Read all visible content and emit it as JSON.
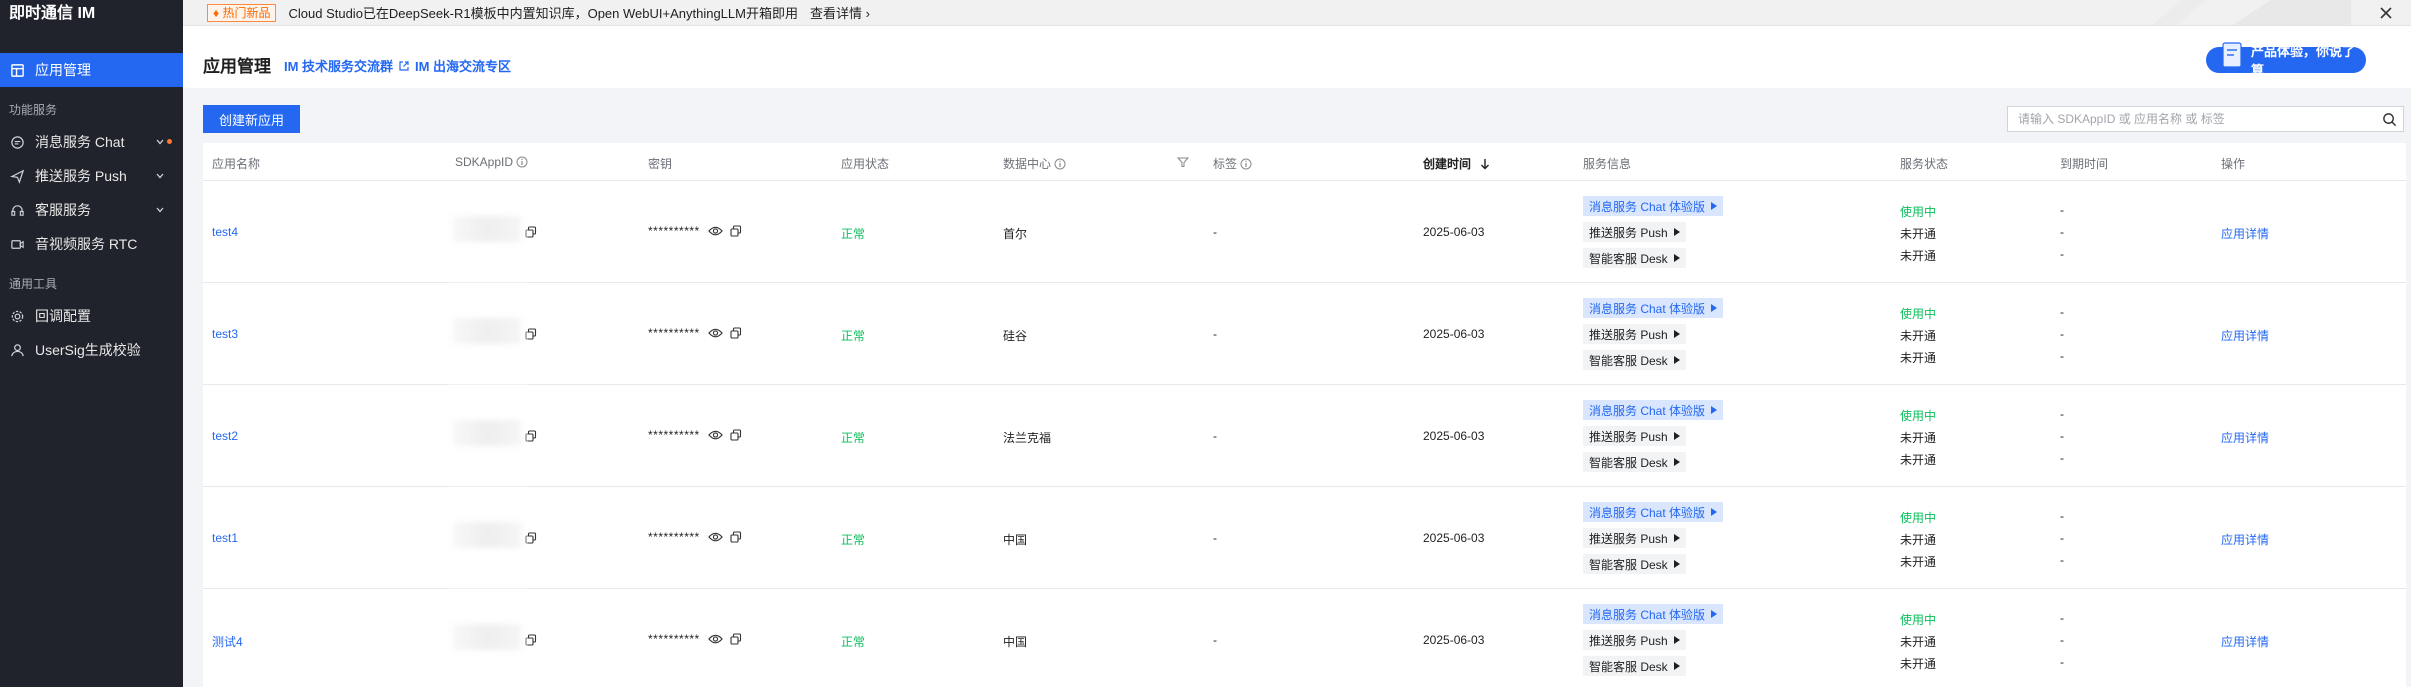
{
  "sidebar": {
    "brand": "即时通信 IM",
    "items": [
      {
        "label": "应用管理",
        "icon": "app-grid-icon"
      },
      {
        "label": "消息服务 Chat",
        "icon": "chat-bubble-icon"
      },
      {
        "label": "推送服务 Push",
        "icon": "push-send-icon"
      },
      {
        "label": "客服服务",
        "icon": "headset-icon"
      },
      {
        "label": "音视频服务 RTC",
        "icon": "video-camera-icon"
      },
      {
        "label": "回调配置",
        "icon": "gear-icon"
      },
      {
        "label": "UserSig生成校验",
        "icon": "user-key-icon"
      }
    ],
    "groups": [
      "功能服务",
      "通用工具"
    ]
  },
  "banner": {
    "tag": "热门新品",
    "text": "Cloud Studio已在DeepSeek-R1模板中内置知识库，Open WebUI+AnythingLLM开箱即用",
    "link": "查看详情"
  },
  "header": {
    "title": "应用管理",
    "link1": "IM 技术服务交流群",
    "link2": "IM 出海交流专区",
    "promo": "产品体验，你说了算"
  },
  "toolbar": {
    "create_label": "创建新应用",
    "search_placeholder": "请输入 SDKAppID 或 应用名称 或 标签"
  },
  "table": {
    "headers": {
      "name": "应用名称",
      "sdkappid": "SDKAppID",
      "secret": "密钥",
      "status": "应用状态",
      "datacenter": "数据中心",
      "tags": "标签",
      "created": "创建时间",
      "services": "服务信息",
      "svc_status": "服务状态",
      "expire": "到期时间",
      "ops": "操作"
    },
    "rows": [
      {
        "name": "test4",
        "secret": "**********",
        "status": "正常",
        "datacenter": "首尔",
        "tags": "-",
        "created": "2025-06-03",
        "svc_chat": "消息服务 Chat 体验版",
        "svc_push": "推送服务 Push",
        "svc_desk": "智能客服 Desk",
        "st_chat": "使用中",
        "st_push": "未开通",
        "st_desk": "未开通",
        "exp1": "-",
        "exp2": "-",
        "exp3": "-",
        "op": "应用详情"
      },
      {
        "name": "test3",
        "secret": "**********",
        "status": "正常",
        "datacenter": "硅谷",
        "tags": "-",
        "created": "2025-06-03",
        "svc_chat": "消息服务 Chat 体验版",
        "svc_push": "推送服务 Push",
        "svc_desk": "智能客服 Desk",
        "st_chat": "使用中",
        "st_push": "未开通",
        "st_desk": "未开通",
        "exp1": "-",
        "exp2": "-",
        "exp3": "-",
        "op": "应用详情"
      },
      {
        "name": "test2",
        "secret": "**********",
        "status": "正常",
        "datacenter": "法兰克福",
        "tags": "-",
        "created": "2025-06-03",
        "svc_chat": "消息服务 Chat 体验版",
        "svc_push": "推送服务 Push",
        "svc_desk": "智能客服 Desk",
        "st_chat": "使用中",
        "st_push": "未开通",
        "st_desk": "未开通",
        "exp1": "-",
        "exp2": "-",
        "exp3": "-",
        "op": "应用详情"
      },
      {
        "name": "test1",
        "secret": "**********",
        "status": "正常",
        "datacenter": "中国",
        "tags": "-",
        "created": "2025-06-03",
        "svc_chat": "消息服务 Chat 体验版",
        "svc_push": "推送服务 Push",
        "svc_desk": "智能客服 Desk",
        "st_chat": "使用中",
        "st_push": "未开通",
        "st_desk": "未开通",
        "exp1": "-",
        "exp2": "-",
        "exp3": "-",
        "op": "应用详情"
      },
      {
        "name": "测试4",
        "secret": "**********",
        "status": "正常",
        "datacenter": "中国",
        "tags": "-",
        "created": "2025-06-03",
        "svc_chat": "消息服务 Chat 体验版",
        "svc_push": "推送服务 Push",
        "svc_desk": "智能客服 Desk",
        "st_chat": "使用中",
        "st_push": "未开通",
        "st_desk": "未开通",
        "exp1": "-",
        "exp2": "-",
        "exp3": "-",
        "op": "应用详情"
      }
    ]
  },
  "colors": {
    "accent": "#2468f2",
    "sidebar_bg": "#20232b",
    "success": "#0abf5b",
    "hot": "#ff6a00"
  }
}
